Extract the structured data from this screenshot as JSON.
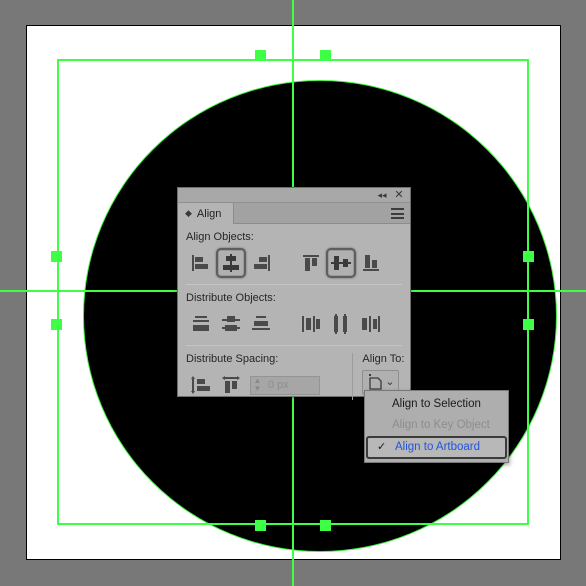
{
  "app": {
    "canvas_background": "#787878",
    "artboard_background": "#ffffff",
    "selection_color": "#3dff46"
  },
  "artboard": {
    "shape": {
      "name": "circle-shape",
      "fill": "#000000",
      "stroke": "#3cf03c"
    },
    "handles": [
      {
        "name": "handle-top-left"
      },
      {
        "name": "handle-top-right"
      },
      {
        "name": "handle-left-top"
      },
      {
        "name": "handle-right-top"
      },
      {
        "name": "handle-left-bottom"
      },
      {
        "name": "handle-right-bottom"
      },
      {
        "name": "handle-bottom-left"
      },
      {
        "name": "handle-bottom-right"
      }
    ]
  },
  "panel": {
    "tab_label": "Align",
    "collapse_icon": "◂◂",
    "close_icon": "✕",
    "menu_icon": "hamburger-menu-icon",
    "sections": {
      "align_objects": {
        "label": "Align Objects:",
        "buttons": [
          {
            "name": "horizontal-align-left",
            "title": "Horizontal Align Left",
            "selected": false
          },
          {
            "name": "horizontal-align-center",
            "title": "Horizontal Align Center",
            "selected": true
          },
          {
            "name": "horizontal-align-right",
            "title": "Horizontal Align Right",
            "selected": false
          },
          {
            "name": "vertical-align-top",
            "title": "Vertical Align Top",
            "selected": false
          },
          {
            "name": "vertical-align-center",
            "title": "Vertical Align Center",
            "selected": true
          },
          {
            "name": "vertical-align-bottom",
            "title": "Vertical Align Bottom",
            "selected": false
          }
        ]
      },
      "distribute_objects": {
        "label": "Distribute Objects:",
        "buttons": [
          {
            "name": "vertical-distribute-top",
            "title": "Vertical Distribute Top"
          },
          {
            "name": "vertical-distribute-center",
            "title": "Vertical Distribute Center"
          },
          {
            "name": "vertical-distribute-bottom",
            "title": "Vertical Distribute Bottom"
          },
          {
            "name": "horizontal-distribute-left",
            "title": "Horizontal Distribute Left"
          },
          {
            "name": "horizontal-distribute-center",
            "title": "Horizontal Distribute Center"
          },
          {
            "name": "horizontal-distribute-right",
            "title": "Horizontal Distribute Right"
          }
        ]
      },
      "distribute_spacing": {
        "label": "Distribute Spacing:",
        "buttons": [
          {
            "name": "vertical-distribute-spacing",
            "title": "Vertical Distribute Space"
          },
          {
            "name": "horizontal-distribute-spacing",
            "title": "Horizontal Distribute Space"
          }
        ],
        "spacing_value": "0 px",
        "spacing_placeholder": "0 px",
        "stepper_up": "▲",
        "stepper_down": "▼"
      },
      "align_to": {
        "label": "Align To:",
        "button_name": "align-to-artboard-button",
        "chevron": "⌄"
      }
    }
  },
  "dropdown": {
    "items": [
      {
        "label": "Align to Selection",
        "checked": false,
        "disabled": false
      },
      {
        "label": "Align to Key Object",
        "checked": false,
        "disabled": true
      },
      {
        "label": "Align to Artboard",
        "checked": true,
        "disabled": false
      }
    ],
    "check_glyph": "✓",
    "highlight_color": "#2255dd"
  }
}
